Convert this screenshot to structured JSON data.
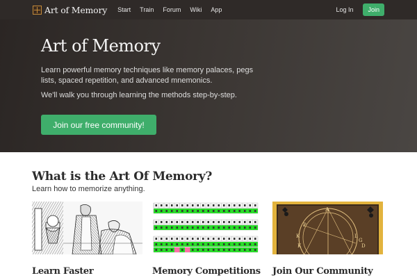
{
  "nav": {
    "brand": "Art of Memory",
    "links": [
      "Start",
      "Train",
      "Forum",
      "Wiki",
      "App"
    ],
    "login": "Log In",
    "join": "Join"
  },
  "hero": {
    "title": "Art of Memory",
    "description": "Learn powerful memory techniques like memory palaces, pegs lists, spaced repetition, and advanced mnemonics.",
    "subtitle": "We'll walk you through learning the methods step-by-step.",
    "cta": "Join our free community!"
  },
  "section": {
    "title": "What is the Art Of Memory?",
    "subtitle": "Learn how to memorize anything."
  },
  "cards": [
    {
      "title": "Learn Faster",
      "image": "classical-engraving-illustration"
    },
    {
      "title": "Memory Competitions",
      "image": "number-grid-scoresheet"
    },
    {
      "title": "Join Our Community",
      "image": "astrological-circle-diagram"
    }
  ],
  "colors": {
    "navbar": "#2f2a28",
    "accent_green": "#3fae6b",
    "hero_bg": "#3a3532"
  }
}
